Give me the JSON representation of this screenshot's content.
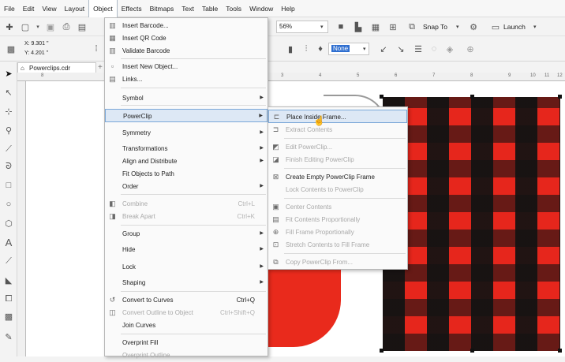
{
  "menubar": [
    "File",
    "Edit",
    "View",
    "Layout",
    "Object",
    "Effects",
    "Bitmaps",
    "Text",
    "Table",
    "Tools",
    "Window",
    "Help"
  ],
  "toolbar": {
    "zoom_value": "56%",
    "snap_label": "Snap To",
    "launch_label": "Launch"
  },
  "propbar": {
    "x_value": "X: 9.301 \"",
    "y_value": "Y: 4.201 \"",
    "outline_value": "None"
  },
  "document": {
    "tab_title": "Powerclips.cdr"
  },
  "ruler_ticks": [
    "8",
    "3",
    "4",
    "5",
    "6",
    "7",
    "8",
    "9",
    "10",
    "11",
    "12"
  ],
  "object_menu": [
    {
      "label": "Insert Barcode...",
      "icon": "barcode-icon",
      "disabled": false,
      "shortcut": "",
      "submenu": false
    },
    {
      "label": "Insert QR Code",
      "icon": "qr-code-icon",
      "disabled": false,
      "shortcut": "",
      "submenu": false
    },
    {
      "label": "Validate Barcode",
      "icon": "validate-barcode-icon",
      "disabled": false,
      "shortcut": "",
      "submenu": false
    },
    {
      "label": "Insert New Object...",
      "icon": "new-object-icon",
      "disabled": false,
      "shortcut": "",
      "submenu": false
    },
    {
      "label": "Links...",
      "icon": "links-icon",
      "disabled": false,
      "shortcut": "",
      "submenu": false
    },
    {
      "label": "Symbol",
      "icon": "",
      "disabled": false,
      "shortcut": "",
      "submenu": true
    },
    {
      "label": "PowerClip",
      "icon": "",
      "disabled": false,
      "shortcut": "",
      "submenu": true,
      "highlighted": true
    },
    {
      "label": "Symmetry",
      "icon": "",
      "disabled": false,
      "shortcut": "",
      "submenu": true
    },
    {
      "label": "Transformations",
      "icon": "",
      "disabled": false,
      "shortcut": "",
      "submenu": true
    },
    {
      "label": "Align and Distribute",
      "icon": "",
      "disabled": false,
      "shortcut": "",
      "submenu": true
    },
    {
      "label": "Fit Objects to Path",
      "icon": "",
      "disabled": false,
      "shortcut": "",
      "submenu": false
    },
    {
      "label": "Order",
      "icon": "",
      "disabled": false,
      "shortcut": "",
      "submenu": true
    },
    {
      "label": "Combine",
      "icon": "combine-icon",
      "disabled": true,
      "shortcut": "Ctrl+L",
      "submenu": false
    },
    {
      "label": "Break Apart",
      "icon": "break-apart-icon",
      "disabled": true,
      "shortcut": "Ctrl+K",
      "submenu": false
    },
    {
      "label": "Group",
      "icon": "",
      "disabled": false,
      "shortcut": "",
      "submenu": true
    },
    {
      "label": "Hide",
      "icon": "",
      "disabled": false,
      "shortcut": "",
      "submenu": true
    },
    {
      "label": "Lock",
      "icon": "",
      "disabled": false,
      "shortcut": "",
      "submenu": true
    },
    {
      "label": "Shaping",
      "icon": "",
      "disabled": false,
      "shortcut": "",
      "submenu": true
    },
    {
      "label": "Convert to Curves",
      "icon": "convert-curves-icon",
      "disabled": false,
      "shortcut": "Ctrl+Q",
      "submenu": false
    },
    {
      "label": "Convert Outline to Object",
      "icon": "convert-outline-icon",
      "disabled": true,
      "shortcut": "Ctrl+Shift+Q",
      "submenu": false
    },
    {
      "label": "Join Curves",
      "icon": "",
      "disabled": false,
      "shortcut": "",
      "submenu": false
    },
    {
      "label": "Overprint Fill",
      "icon": "",
      "disabled": false,
      "shortcut": "",
      "submenu": false
    },
    {
      "label": "Overprint Outline",
      "icon": "",
      "disabled": true,
      "shortcut": "",
      "submenu": false
    }
  ],
  "powerclip_menu": [
    {
      "label": "Place Inside Frame...",
      "icon": "place-inside-icon",
      "disabled": false,
      "highlighted": true
    },
    {
      "label": "Extract Contents",
      "icon": "extract-icon",
      "disabled": true
    },
    {
      "label": "Edit PowerClip...",
      "icon": "edit-powerclip-icon",
      "disabled": true
    },
    {
      "label": "Finish Editing PowerClip",
      "icon": "finish-edit-icon",
      "disabled": true
    },
    {
      "label": "Create Empty PowerClip Frame",
      "icon": "empty-frame-icon",
      "disabled": false
    },
    {
      "label": "Lock Contents to PowerClip",
      "icon": "",
      "disabled": true
    },
    {
      "label": "Center Contents",
      "icon": "center-icon",
      "disabled": true
    },
    {
      "label": "Fit Contents Proportionally",
      "icon": "fit-icon",
      "disabled": true
    },
    {
      "label": "Fill Frame Proportionally",
      "icon": "fill-frame-icon",
      "disabled": true
    },
    {
      "label": "Stretch Contents to Fill Frame",
      "icon": "stretch-icon",
      "disabled": true
    },
    {
      "label": "Copy PowerClip From...",
      "icon": "copy-powerclip-icon",
      "disabled": true
    }
  ],
  "colors": {
    "accent": "#7aa7d8",
    "plaid_red": "#e6261c",
    "plaid_black": "#121212"
  }
}
